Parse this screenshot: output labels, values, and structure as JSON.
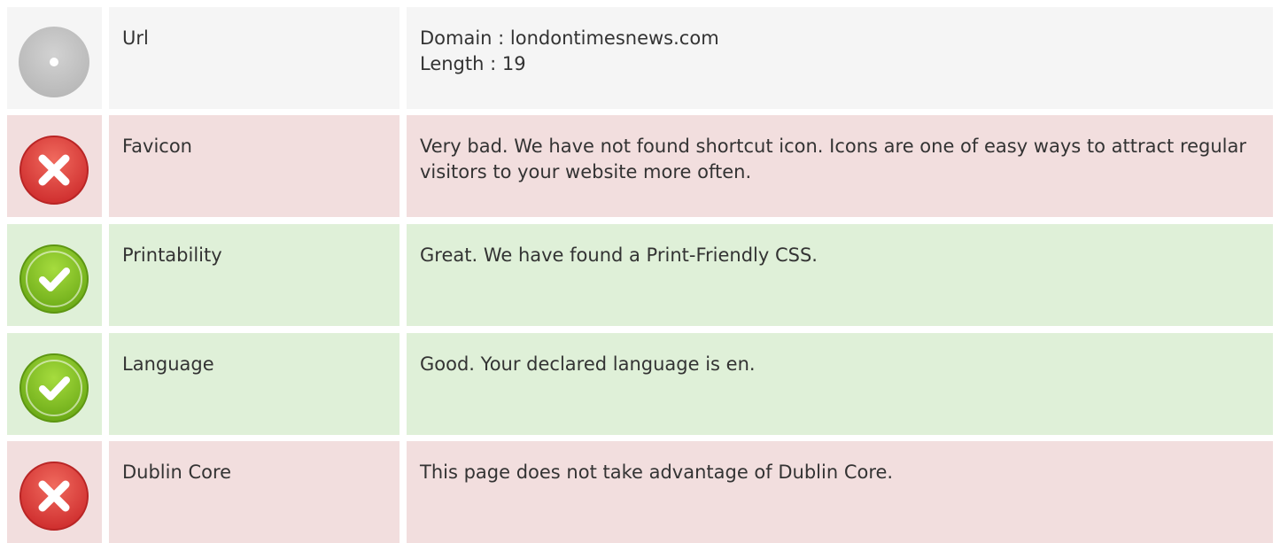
{
  "rows": [
    {
      "status": "neutral",
      "icon": "neutral-circle-icon",
      "label": "Url",
      "lines": [
        "Domain : londontimesnews.com",
        "Length : 19"
      ]
    },
    {
      "status": "bad",
      "icon": "error-x-icon",
      "label": "Favicon",
      "lines": [
        "Very bad. We have not found shortcut icon. Icons are one of easy ways to attract regular visitors to your website more often."
      ]
    },
    {
      "status": "good",
      "icon": "check-icon",
      "label": "Printability",
      "lines": [
        "Great. We have found a Print-Friendly CSS."
      ]
    },
    {
      "status": "good",
      "icon": "check-icon",
      "label": "Language",
      "lines": [
        "Good. Your declared language is en."
      ]
    },
    {
      "status": "bad",
      "icon": "error-x-icon",
      "label": "Dublin Core",
      "lines": [
        "This page does not take advantage of Dublin Core."
      ]
    }
  ],
  "colors": {
    "neutral_bg": "#f5f5f5",
    "bad_bg": "#f2dede",
    "good_bg": "#dff0d8",
    "bad_icon": "#e03b3b",
    "good_icon": "#7cbb1e",
    "neutral_icon": "#c4c4c4"
  }
}
